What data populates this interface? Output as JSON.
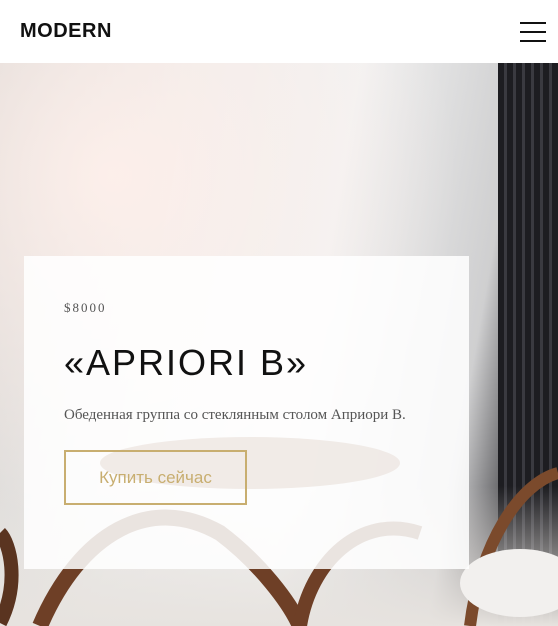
{
  "header": {
    "logo": "MODERN",
    "menu_icon": "hamburger-menu-icon"
  },
  "hero": {
    "price": "$8000",
    "title": "«APRIORI B»",
    "description": "Обеденная группа со стеклянным столом Априори В.",
    "cta_label": "Купить сейчас"
  },
  "colors": {
    "accent": "#c8ae70",
    "text_dark": "#111111",
    "text_muted": "#555555"
  }
}
